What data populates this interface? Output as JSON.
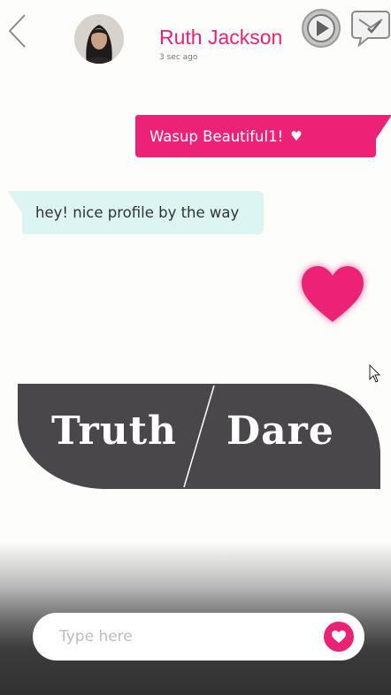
{
  "header": {
    "contact_name": "Ruth Jackson",
    "last_seen": "3 sec ago",
    "back_icon": "chevron-left-icon",
    "play_icon": "play-icon",
    "inbox_icon": "mail-check-icon"
  },
  "messages": [
    {
      "direction": "sent",
      "text": "Wasup Beautiful1!",
      "emoji": "♥"
    },
    {
      "direction": "received",
      "text": "hey! nice profile by the way"
    }
  ],
  "reaction": {
    "icon": "heart-icon"
  },
  "game": {
    "truth_label": "Truth",
    "dare_label": "Dare"
  },
  "composer": {
    "placeholder": "Type here",
    "value": "",
    "send_icon": "heart-icon"
  },
  "colors": {
    "accent": "#ec2277",
    "received_bubble": "#dcf4f2",
    "card": "#49474a"
  }
}
